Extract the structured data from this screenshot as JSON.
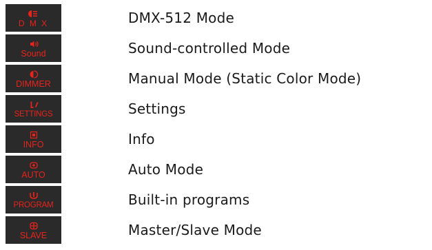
{
  "modes": [
    {
      "badge": "D M X",
      "icon": "dmx-icon",
      "label": "DMX-512 Mode"
    },
    {
      "badge": "Sound",
      "icon": "sound-icon",
      "label": "Sound-controlled Mode"
    },
    {
      "badge": "DIMMER",
      "icon": "dimmer-icon",
      "label": "Manual Mode (Static Color Mode)"
    },
    {
      "badge": "SETTINGS",
      "icon": "settings-icon",
      "label": "Settings"
    },
    {
      "badge": "INFO",
      "icon": "info-icon",
      "label": "Info"
    },
    {
      "badge": "AUTO",
      "icon": "auto-icon",
      "label": "Auto Mode"
    },
    {
      "badge": "PROGRAM",
      "icon": "program-icon",
      "label": "Built-in programs"
    },
    {
      "badge": "SLAVE",
      "icon": "slave-icon",
      "label": "Master/Slave Mode"
    }
  ],
  "colors": {
    "badge_background": "#2a2a2a",
    "badge_text": "#e8231c",
    "label_text": "#1a1a1a"
  }
}
